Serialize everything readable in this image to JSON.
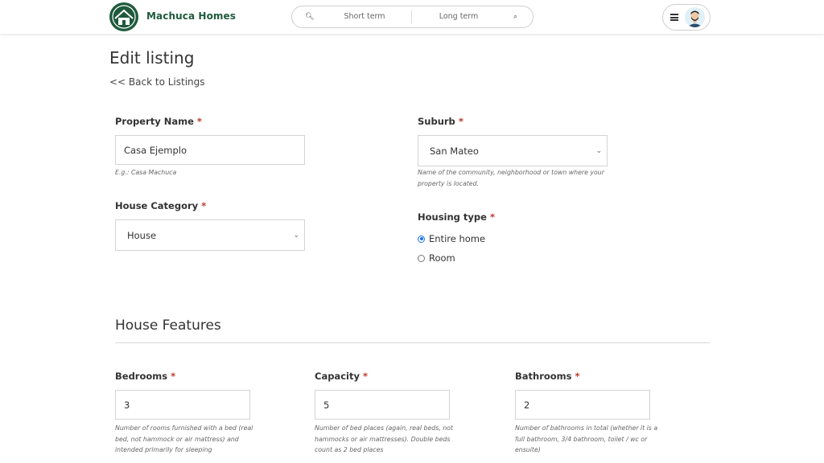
{
  "header": {
    "brand": "Machuca Homes",
    "search": {
      "short_term": "Short term",
      "long_term": "Long term"
    },
    "icons": [
      "search-icon",
      "menu-icon",
      "user-avatar"
    ]
  },
  "page": {
    "title": "Edit listing",
    "back_link": "<< Back to Listings"
  },
  "form": {
    "property_name": {
      "label": "Property Name",
      "required": "*",
      "value": "Casa Ejemplo",
      "help": "E.g.: Casa Machuca"
    },
    "suburb": {
      "label": "Suburb",
      "required": "*",
      "value": "San Mateo",
      "help_1": "Name of the community, neighborhood or town where your",
      "help_2": "property is located."
    },
    "house_category": {
      "label": "House Category",
      "required": "*",
      "value": "House"
    },
    "housing_type": {
      "label": "Housing type",
      "required": "*",
      "options": [
        "Entire home",
        "Room"
      ],
      "selected": "Entire home"
    }
  },
  "features": {
    "title": "House Features",
    "bedrooms": {
      "label": "Bedrooms",
      "required": "*",
      "value": "3",
      "help_1": "Number of rooms furnished with a bed (real",
      "help_2": "bed, not hammock or air mattress) and",
      "help_3": "intended primarily for sleeping"
    },
    "capacity": {
      "label": "Capacity",
      "required": "*",
      "value": "5",
      "help_1": "Number of bed places (again, real beds, not",
      "help_2": "hammocks or air mattresses). Double beds",
      "help_3": "count as 2 bed places"
    },
    "bathrooms": {
      "label": "Bathrooms",
      "required": "*",
      "value": "2",
      "help_1": "Number of bathrooms in total (whether it is a",
      "help_2": "full bathroom, 3/4 bathroom, toilet / wc or",
      "help_3": "ensuite)"
    }
  },
  "colors": {
    "brand": "#1f5a3c",
    "required": "#c0392b",
    "radio": "#1a73e8"
  }
}
